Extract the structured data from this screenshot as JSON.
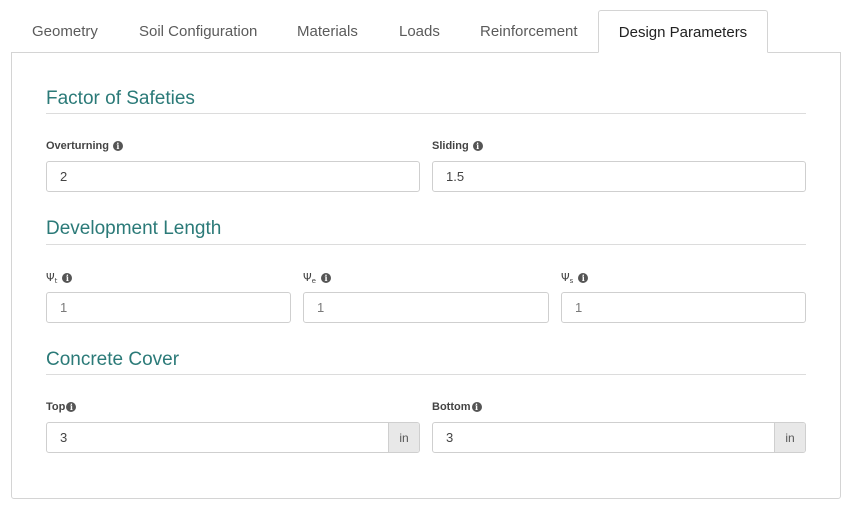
{
  "tabs": [
    {
      "label": "Geometry",
      "active": false
    },
    {
      "label": "Soil Configuration",
      "active": false
    },
    {
      "label": "Materials",
      "active": false
    },
    {
      "label": "Loads",
      "active": false
    },
    {
      "label": "Reinforcement",
      "active": false
    },
    {
      "label": "Design Parameters",
      "active": true
    }
  ],
  "sections": {
    "factor_of_safeties": {
      "title": "Factor of Safeties",
      "overturning": {
        "label": "Overturning",
        "value": "2"
      },
      "sliding": {
        "label": "Sliding",
        "value": "1.5"
      }
    },
    "development_length": {
      "title": "Development Length",
      "psi_t": {
        "symbol": "Ψ",
        "sub": "t",
        "value": "1"
      },
      "psi_e": {
        "symbol": "Ψ",
        "sub": "e",
        "value": "1"
      },
      "psi_s": {
        "symbol": "Ψ",
        "sub": "s",
        "value": "1"
      }
    },
    "concrete_cover": {
      "title": "Concrete Cover",
      "top": {
        "label": "Top",
        "value": "3",
        "unit": "in"
      },
      "bottom": {
        "label": "Bottom",
        "value": "3",
        "unit": "in"
      }
    }
  },
  "icons": {
    "info": "info-icon",
    "info_glyph": "i"
  },
  "colors": {
    "section_title": "#2b7a78",
    "border": "#d4d4d4",
    "addon_bg": "#e8e8e8"
  }
}
